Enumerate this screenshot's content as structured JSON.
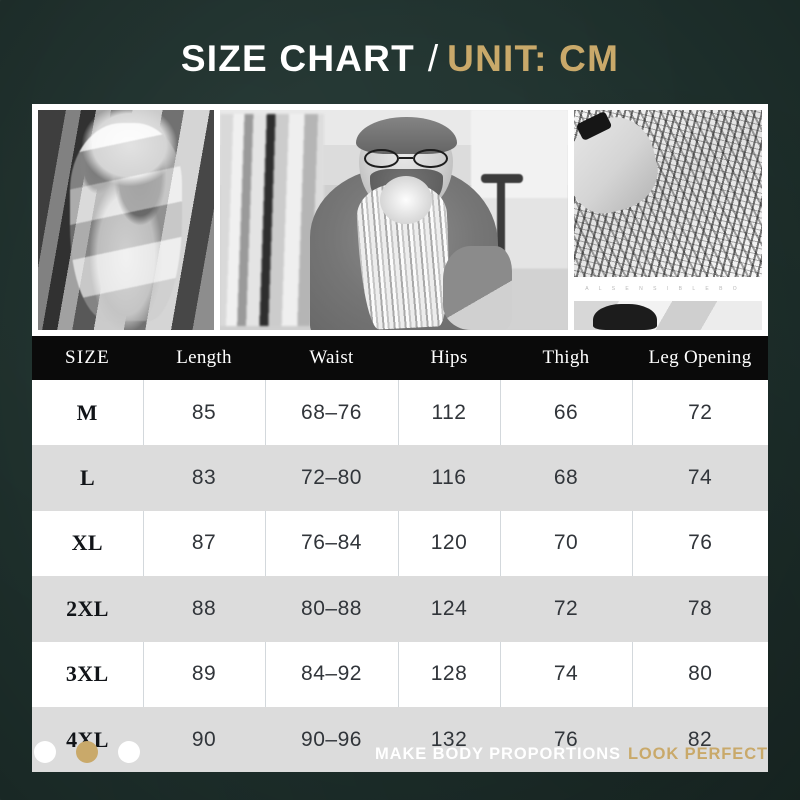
{
  "header": {
    "title_main": "SIZE CHART",
    "separator": "/",
    "title_accent": "UNIT: CM"
  },
  "photos": [
    {
      "name": "mannequin",
      "alt": "Draped garment on a dress form mannequin"
    },
    {
      "name": "tailor",
      "alt": "Bearded tailor with glasses and scarf in a studio"
    },
    {
      "name": "beadwork",
      "alt": "Hands working on beaded embellished fabric",
      "caption": "A L   S E N S I B L E   B O"
    }
  ],
  "table": {
    "columns": [
      "SIZE",
      "Length",
      "Waist",
      "Hips",
      "Thigh",
      "Leg Opening"
    ],
    "rows": [
      {
        "size": "M",
        "length": "85",
        "waist": "68‒76",
        "hips": "112",
        "thigh": "66",
        "leg_opening": "72"
      },
      {
        "size": "L",
        "length": "83",
        "waist": "72‒80",
        "hips": "116",
        "thigh": "68",
        "leg_opening": "74"
      },
      {
        "size": "XL",
        "length": "87",
        "waist": "76‒84",
        "hips": "120",
        "thigh": "70",
        "leg_opening": "76"
      },
      {
        "size": "2XL",
        "length": "88",
        "waist": "80‒88",
        "hips": "124",
        "thigh": "72",
        "leg_opening": "78"
      },
      {
        "size": "3XL",
        "length": "89",
        "waist": "84‒92",
        "hips": "128",
        "thigh": "74",
        "leg_opening": "80"
      },
      {
        "size": "4XL",
        "length": "90",
        "waist": "90‒96",
        "hips": "132",
        "thigh": "76",
        "leg_opening": "82"
      }
    ]
  },
  "footer": {
    "tagline_primary": "MAKE BODY PROPORTIONS",
    "tagline_accent": "LOOK PERFECT",
    "dots": [
      {
        "state": "inactive"
      },
      {
        "state": "active"
      },
      {
        "state": "inactive"
      }
    ]
  },
  "colors": {
    "background": "#20332f",
    "accent_gold": "#c9a96a",
    "header_bar": "#0a0a0a",
    "row_white": "#ffffff",
    "row_gray": "#dcdcdc"
  }
}
